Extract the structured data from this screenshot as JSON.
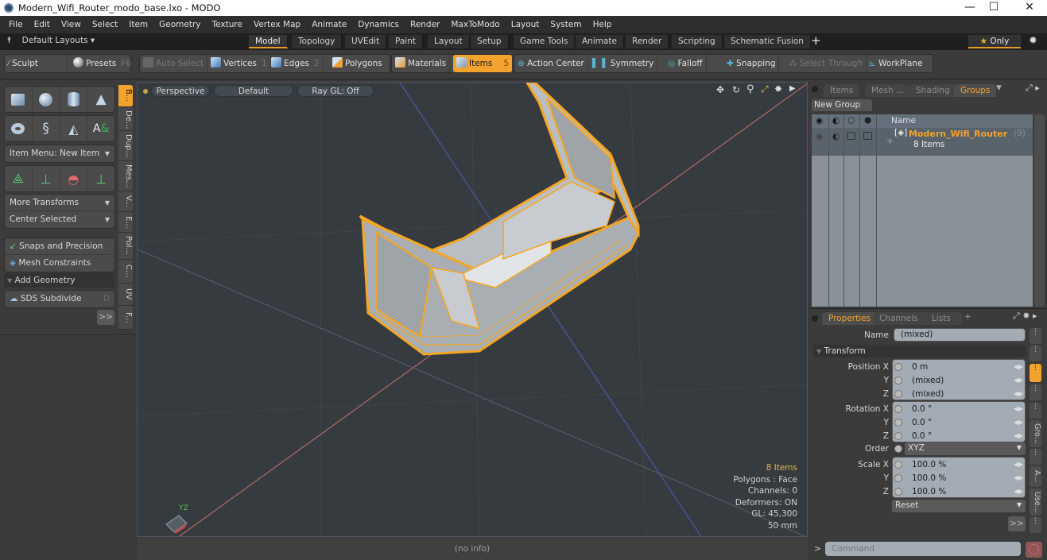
{
  "window": {
    "title": "Modern_Wifi_Router_modo_base.lxo - MODO",
    "controls": [
      "minimize",
      "maximize",
      "close"
    ]
  },
  "menu": [
    "File",
    "Edit",
    "View",
    "Select",
    "Item",
    "Geometry",
    "Texture",
    "Vertex Map",
    "Animate",
    "Dynamics",
    "Render",
    "MaxToModo",
    "Layout",
    "System",
    "Help"
  ],
  "layout_bar": {
    "layouts_label": "Default Layouts ▾",
    "tabs": [
      "Model",
      "Topology",
      "UVEdit",
      "Paint",
      "Layout",
      "Setup",
      "Game Tools",
      "Animate",
      "Render",
      "Scripting",
      "Schematic Fusion"
    ],
    "active_tab": "Model",
    "add_label": "+",
    "only_label": "Only"
  },
  "toolbar": {
    "sculpt": "Sculpt",
    "presets": "Presets",
    "presets_shortcut": "F6",
    "auto_select": "Auto Select",
    "vertices": "Vertices",
    "vertices_num": "1",
    "edges": "Edges",
    "edges_num": "2",
    "polygons": "Polygons",
    "materials": "Materials",
    "items": "Items",
    "items_num": "5",
    "action_center": "Action Center",
    "symmetry": "Symmetry",
    "falloff": "Falloff",
    "snapping": "Snapping",
    "select_through": "Select Through",
    "workplane": "WorkPlane"
  },
  "left_panel": {
    "item_menu": "Item Menu: New Item",
    "more_transforms": "More Transforms",
    "center_selected": "Center Selected",
    "snaps": "Snaps and Precision",
    "mesh_constraints": "Mesh Constraints",
    "add_geometry": "Add Geometry",
    "sds_subdivide": "SDS Subdivide",
    "sds_shortcut": "D",
    "more": ">>",
    "vtabs": [
      "B...",
      "De...",
      "Dup...",
      "Mes...",
      "V...",
      "E...",
      "Pol...",
      "C...",
      "UV",
      "F..."
    ]
  },
  "viewport": {
    "view": "Perspective",
    "style": "Default",
    "raygl": "Ray GL: Off",
    "info": {
      "items": "8 Items",
      "polygons": "Polygons : Face",
      "channels": "Channels: 0",
      "deformers": "Deformers: ON",
      "gl": "GL: 45,300",
      "scale": "50 mm"
    },
    "axis_label": "YZ",
    "status": "(no info)"
  },
  "groups_panel": {
    "tabs": [
      "Items",
      "Mesh ...",
      "Shading",
      "Groups"
    ],
    "active_tab": "Groups",
    "new_group": "New Group",
    "header_name": "Name",
    "group": {
      "name": "Modern_Wifi_Router",
      "count": "(9)",
      "sub": "8 Items"
    }
  },
  "properties_panel": {
    "tabs": [
      "Properties",
      "Channels",
      "Lists",
      "+"
    ],
    "active_tab": "Properties",
    "name_label": "Name",
    "name_value": "(mixed)",
    "section": "Transform",
    "position": {
      "label": "Position",
      "x": "0 m",
      "y": "(mixed)",
      "z": "(mixed)"
    },
    "rotation": {
      "label": "Rotation",
      "x": "0.0 °",
      "y": "0.0 °",
      "z": "0.0 °"
    },
    "order": {
      "label": "Order",
      "value": "XYZ"
    },
    "scale": {
      "label": "Scale",
      "x": "100.0 %",
      "y": "100.0 %",
      "z": "100.0 %"
    },
    "axis_x": "X",
    "axis_y": "Y",
    "axis_z": "Z",
    "reset": "Reset",
    "more": ">>",
    "side_tabs": [
      "Gro...",
      "A...",
      "Use..."
    ]
  },
  "command": {
    "prompt": ">",
    "placeholder": "Command"
  },
  "colors": {
    "accent": "#f3a22e",
    "selection": "#f5a623",
    "viewport_bg": "#363b40"
  }
}
